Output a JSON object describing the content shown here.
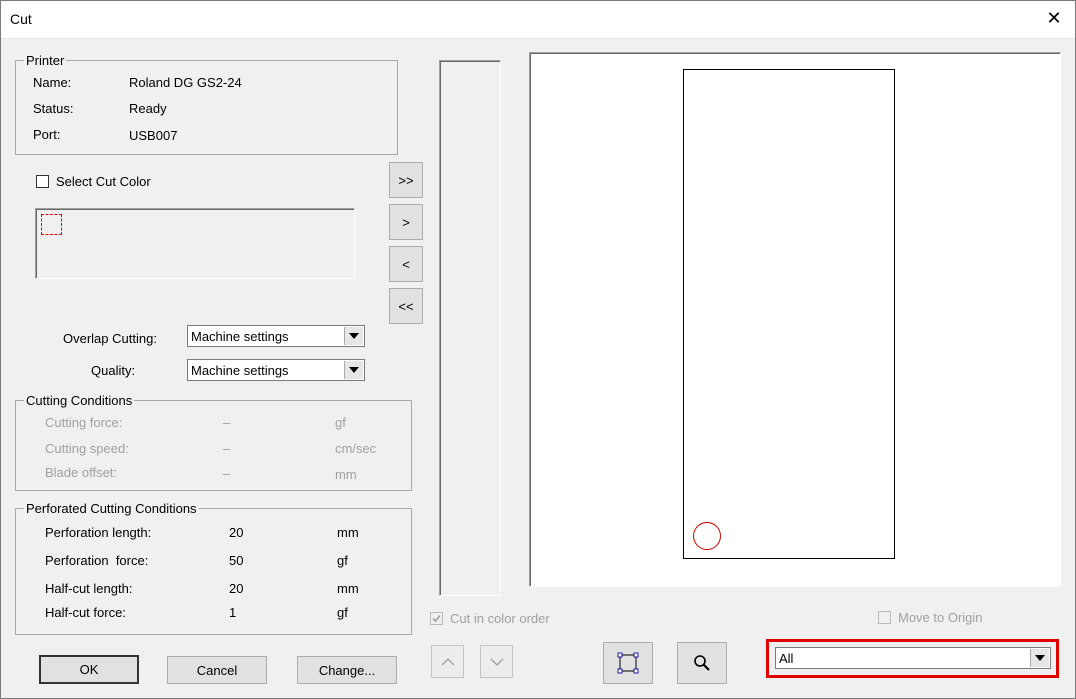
{
  "window": {
    "title": "Cut",
    "close_glyph": "✕"
  },
  "printer": {
    "group_label": "Printer",
    "name_label": "Name:",
    "name_value": "Roland DG GS2-24",
    "status_label": "Status:",
    "status_value": "Ready",
    "port_label": "Port:",
    "port_value": "USB007"
  },
  "select_cut_color": {
    "label": "Select Cut Color",
    "checked": false
  },
  "move_buttons": {
    "all_right": ">>",
    "right": ">",
    "left": "<",
    "all_left": "<<"
  },
  "overlap_cutting": {
    "label": "Overlap Cutting:",
    "value": "Machine settings"
  },
  "quality": {
    "label": "Quality:",
    "value": "Machine settings"
  },
  "cutting_conditions": {
    "group_label": "Cutting Conditions",
    "rows": [
      {
        "label": "Cutting force:",
        "value": "–",
        "unit": "gf"
      },
      {
        "label": "Cutting speed:",
        "value": "–",
        "unit": "cm/sec"
      },
      {
        "label": "Blade offset:",
        "value": "–",
        "unit": "mm"
      }
    ]
  },
  "perforated_conditions": {
    "group_label": "Perforated Cutting Conditions",
    "rows": [
      {
        "label": "Perforation length:",
        "value": "20",
        "unit": "mm"
      },
      {
        "label": "Perforation  force:",
        "value": "50",
        "unit": "gf"
      },
      {
        "label": "Half-cut length:",
        "value": "20",
        "unit": "mm"
      },
      {
        "label": "Half-cut force:",
        "value": "1",
        "unit": "gf"
      }
    ]
  },
  "cut_in_color_order": {
    "label": "Cut in color order",
    "checked": true,
    "enabled": false
  },
  "move_to_origin": {
    "label": "Move to Origin",
    "checked": false,
    "enabled": false
  },
  "footer": {
    "ok": "OK",
    "cancel": "Cancel",
    "change": "Change..."
  },
  "view_filter": {
    "value": "All"
  },
  "colors": {
    "highlight": "#e00000",
    "cut_line": "#d00000"
  }
}
